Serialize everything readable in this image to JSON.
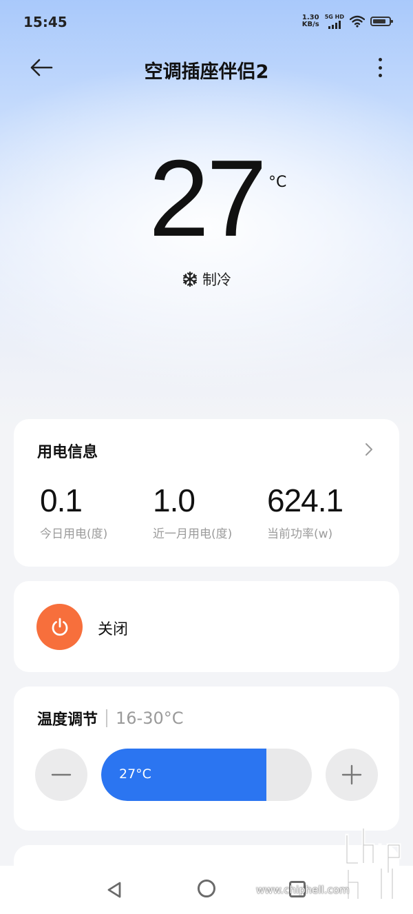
{
  "status_bar": {
    "time": "15:45",
    "net_speed_value": "1.30",
    "net_speed_unit": "KB/s",
    "network_tag": "5G HD"
  },
  "header": {
    "title": "空调插座伴侣2",
    "back_icon": "arrow-left-icon",
    "more_icon": "more-vertical-icon"
  },
  "climate": {
    "temperature": "27",
    "unit": "°C",
    "mode_icon": "snowflake-icon",
    "mode": "制冷"
  },
  "energy": {
    "title": "用电信息",
    "metrics": [
      {
        "value": "0.1",
        "label": "今日用电(度)"
      },
      {
        "value": "1.0",
        "label": "近一月用电(度)"
      },
      {
        "value": "624.1",
        "label": "当前功率(w)"
      }
    ]
  },
  "power": {
    "label": "关闭",
    "icon": "power-icon",
    "color": "#f76f3c"
  },
  "temp_control": {
    "title": "温度调节",
    "range": "16-30°C",
    "current": "27°C",
    "min": 16,
    "max": 30,
    "value": 27,
    "fill_color": "#2b75f1"
  },
  "watermark": {
    "url": "www.chiphell.com"
  }
}
